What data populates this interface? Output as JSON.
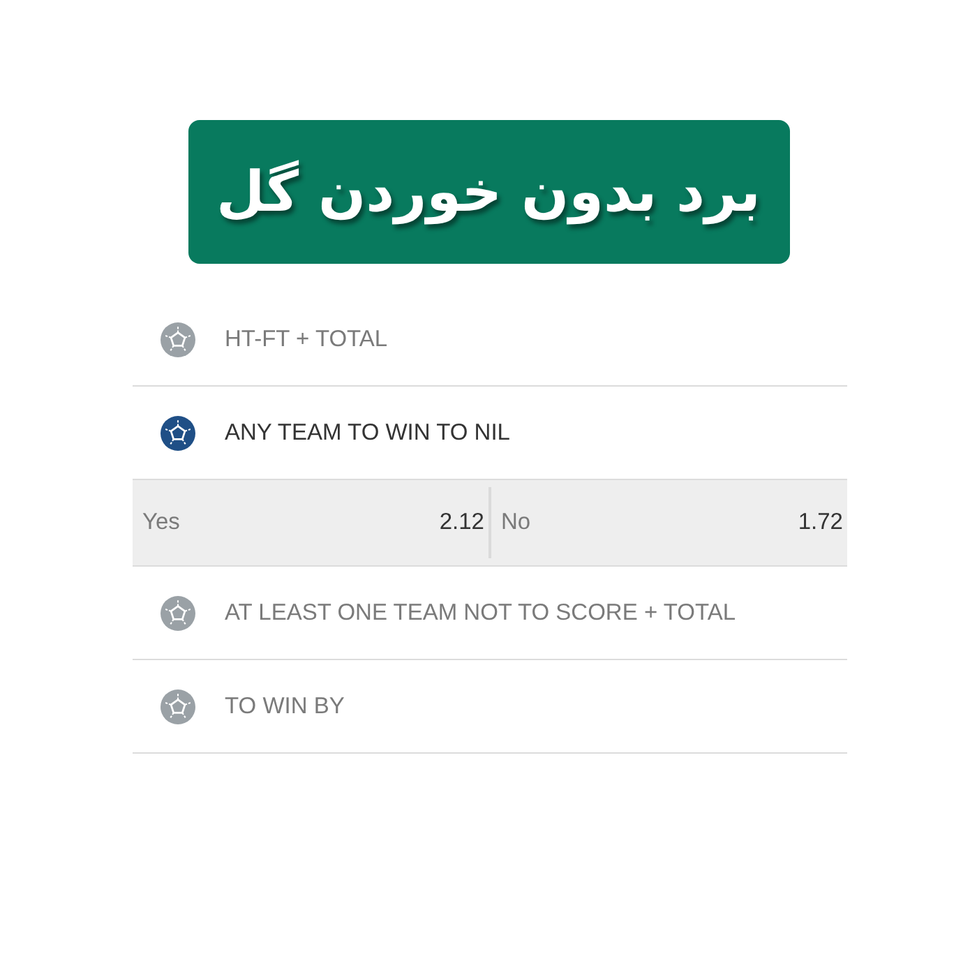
{
  "banner": {
    "title": "برد بدون خوردن گل"
  },
  "markets": [
    {
      "name": "HT-FT + TOTAL",
      "expanded": false
    },
    {
      "name": "ANY TEAM TO WIN TO NIL",
      "expanded": true,
      "outcomes": [
        {
          "label": "Yes",
          "odds": "2.12"
        },
        {
          "label": "No",
          "odds": "1.72"
        }
      ]
    },
    {
      "name": "AT LEAST ONE TEAM NOT TO SCORE + TOTAL",
      "expanded": false
    },
    {
      "name": "TO WIN BY",
      "expanded": false
    }
  ]
}
